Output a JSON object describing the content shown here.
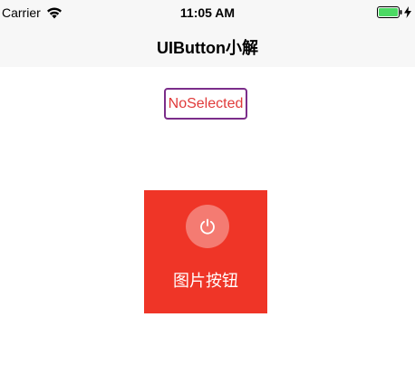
{
  "status_bar": {
    "carrier": "Carrier",
    "time": "11:05 AM",
    "wifi_icon": "wifi-icon",
    "battery_icon": "battery-icon",
    "charging_icon": "charging-icon",
    "battery_color": "#4cd964"
  },
  "nav": {
    "title": "UIButton小解"
  },
  "select_button": {
    "label": "NoSelected",
    "text_color": "#e03a3a",
    "border_color": "#7b2d8a"
  },
  "image_button": {
    "label": "图片按钮",
    "icon": "power-icon",
    "background": "#ef3527"
  }
}
